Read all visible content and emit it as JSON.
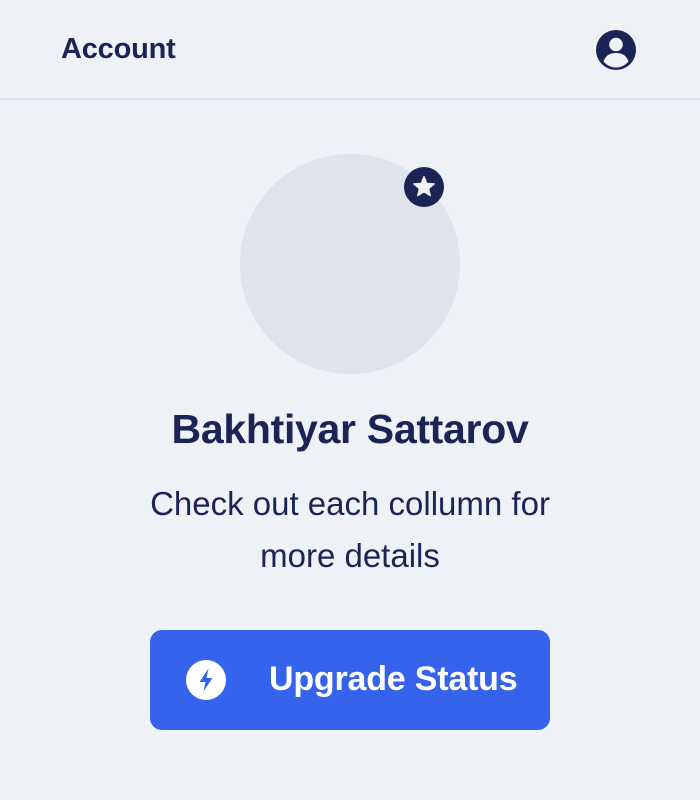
{
  "header": {
    "title": "Account",
    "account_icon": "account-circle-icon"
  },
  "profile": {
    "avatar": "avatar-placeholder",
    "badge_icon": "star-badge-icon",
    "name": "Bakhtiyar Sattarov",
    "description": "Check out each collumn for more details"
  },
  "upgrade": {
    "label": "Upgrade Status",
    "icon": "bolt-icon"
  },
  "colors": {
    "background": "#eef2f7",
    "text": "#1a2455",
    "avatar": "#dfe4eb",
    "accent": "#3563ec",
    "divider": "#dde3ec"
  }
}
